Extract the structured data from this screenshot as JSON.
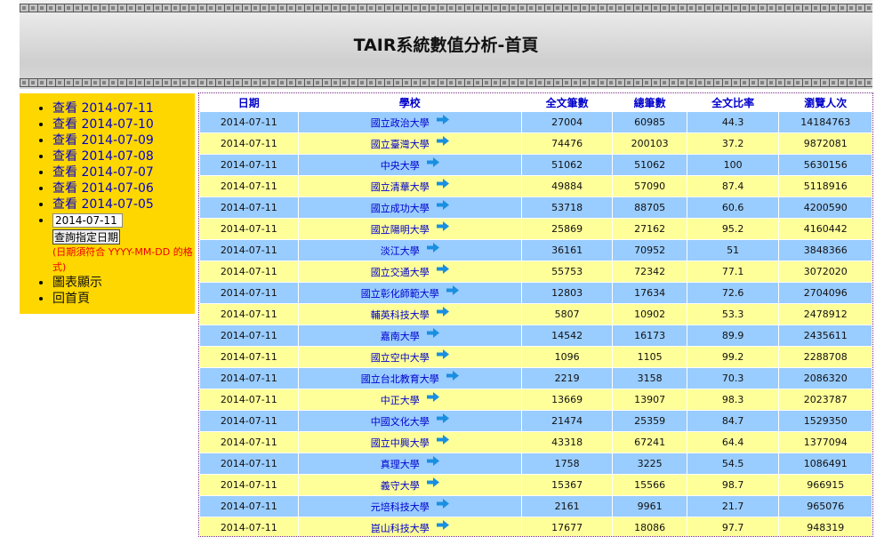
{
  "header": {
    "title": "TAIR系統數值分析-首頁"
  },
  "sidebar": {
    "links": [
      "查看 2014-07-11",
      "查看 2014-07-10",
      "查看 2014-07-09",
      "查看 2014-07-08",
      "查看 2014-07-07",
      "查看 2014-07-06",
      "查看 2014-07-05"
    ],
    "date_input_value": "2014-07-11",
    "query_button": "查詢指定日期",
    "hint": "(日期須符合 YYYY-MM-DD 的格式)",
    "chart_link": "圖表顯示",
    "home_link": "回首頁"
  },
  "table": {
    "headers": [
      "日期",
      "學校",
      "全文筆數",
      "總筆數",
      "全文比率",
      "瀏覽人次"
    ],
    "rows": [
      {
        "date": "2014-07-11",
        "school": "國立政治大學",
        "fulltext": "27004",
        "total": "60985",
        "ratio": "44.3",
        "views": "14184763"
      },
      {
        "date": "2014-07-11",
        "school": "國立臺灣大學",
        "fulltext": "74476",
        "total": "200103",
        "ratio": "37.2",
        "views": "9872081"
      },
      {
        "date": "2014-07-11",
        "school": "中央大學",
        "fulltext": "51062",
        "total": "51062",
        "ratio": "100",
        "views": "5630156"
      },
      {
        "date": "2014-07-11",
        "school": "國立清華大學",
        "fulltext": "49884",
        "total": "57090",
        "ratio": "87.4",
        "views": "5118916"
      },
      {
        "date": "2014-07-11",
        "school": "國立成功大學",
        "fulltext": "53718",
        "total": "88705",
        "ratio": "60.6",
        "views": "4200590"
      },
      {
        "date": "2014-07-11",
        "school": "國立陽明大學",
        "fulltext": "25869",
        "total": "27162",
        "ratio": "95.2",
        "views": "4160442"
      },
      {
        "date": "2014-07-11",
        "school": "淡江大學",
        "fulltext": "36161",
        "total": "70952",
        "ratio": "51",
        "views": "3848366"
      },
      {
        "date": "2014-07-11",
        "school": "國立交通大學",
        "fulltext": "55753",
        "total": "72342",
        "ratio": "77.1",
        "views": "3072020"
      },
      {
        "date": "2014-07-11",
        "school": "國立彰化師範大學",
        "fulltext": "12803",
        "total": "17634",
        "ratio": "72.6",
        "views": "2704096"
      },
      {
        "date": "2014-07-11",
        "school": "輔英科技大學",
        "fulltext": "5807",
        "total": "10902",
        "ratio": "53.3",
        "views": "2478912"
      },
      {
        "date": "2014-07-11",
        "school": "嘉南大學",
        "fulltext": "14542",
        "total": "16173",
        "ratio": "89.9",
        "views": "2435611"
      },
      {
        "date": "2014-07-11",
        "school": "國立空中大學",
        "fulltext": "1096",
        "total": "1105",
        "ratio": "99.2",
        "views": "2288708"
      },
      {
        "date": "2014-07-11",
        "school": "國立台北教育大學",
        "fulltext": "2219",
        "total": "3158",
        "ratio": "70.3",
        "views": "2086320"
      },
      {
        "date": "2014-07-11",
        "school": "中正大學",
        "fulltext": "13669",
        "total": "13907",
        "ratio": "98.3",
        "views": "2023787"
      },
      {
        "date": "2014-07-11",
        "school": "中國文化大學",
        "fulltext": "21474",
        "total": "25359",
        "ratio": "84.7",
        "views": "1529350"
      },
      {
        "date": "2014-07-11",
        "school": "國立中興大學",
        "fulltext": "43318",
        "total": "67241",
        "ratio": "64.4",
        "views": "1377094"
      },
      {
        "date": "2014-07-11",
        "school": "真理大學",
        "fulltext": "1758",
        "total": "3225",
        "ratio": "54.5",
        "views": "1086491"
      },
      {
        "date": "2014-07-11",
        "school": "義守大學",
        "fulltext": "15367",
        "total": "15566",
        "ratio": "98.7",
        "views": "966915"
      },
      {
        "date": "2014-07-11",
        "school": "元培科技大學",
        "fulltext": "2161",
        "total": "9961",
        "ratio": "21.7",
        "views": "965076"
      },
      {
        "date": "2014-07-11",
        "school": "崑山科技大學",
        "fulltext": "17677",
        "total": "18086",
        "ratio": "97.7",
        "views": "948319"
      }
    ]
  },
  "colors": {
    "row_odd": "#99ccff",
    "row_even": "#ffff99",
    "sidebar_bg": "#ffd700",
    "link": "#0000cc",
    "arrow": "#1a8fe0",
    "hint": "#ee0000"
  },
  "icons": {
    "row_link": "arrow-right-icon"
  }
}
